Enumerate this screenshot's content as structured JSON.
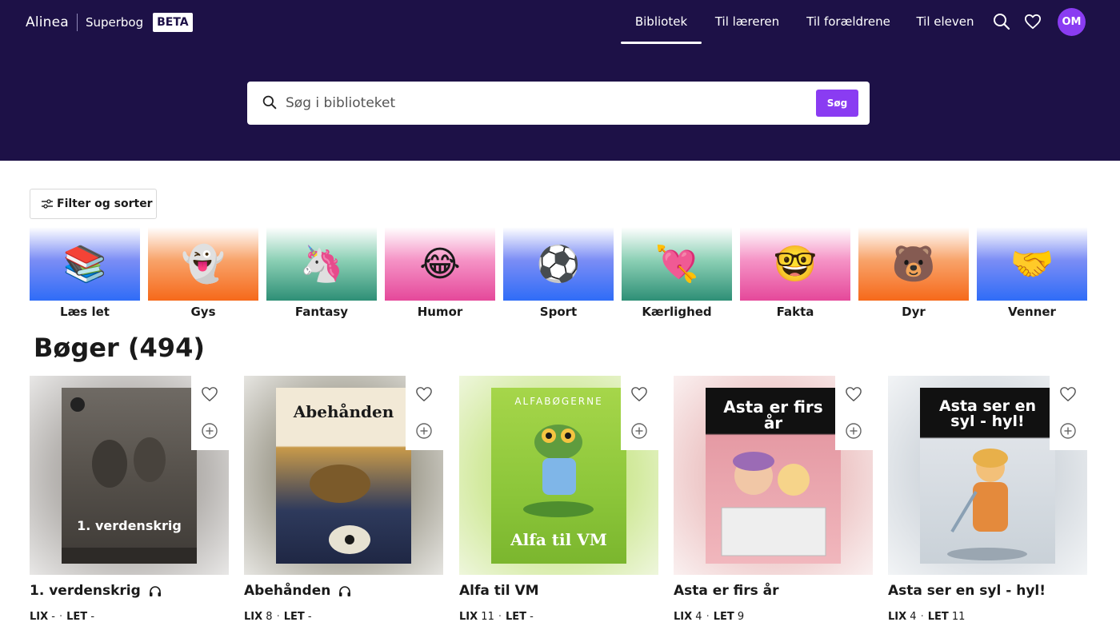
{
  "header": {
    "brand": "Alinea",
    "product": "Superbog",
    "badge": "BETA",
    "nav": [
      {
        "label": "Bibliotek",
        "active": true
      },
      {
        "label": "Til læreren",
        "active": false
      },
      {
        "label": "Til forældrene",
        "active": false
      },
      {
        "label": "Til eleven",
        "active": false
      }
    ],
    "icons": {
      "search": "search-icon",
      "favorites": "heart-icon"
    },
    "avatar_initials": "OM"
  },
  "search": {
    "placeholder": "Søg i biblioteket",
    "value": "",
    "button_label": "Søg"
  },
  "filter": {
    "label": "Filter og sorter",
    "icon": "sliders-icon"
  },
  "categories": [
    {
      "label": "Læs let",
      "emoji": "📚",
      "gradient": "blue"
    },
    {
      "label": "Gys",
      "emoji": "👻",
      "gradient": "orange"
    },
    {
      "label": "Fantasy",
      "emoji": "🦄",
      "gradient": "green"
    },
    {
      "label": "Humor",
      "emoji": "😂",
      "gradient": "pink"
    },
    {
      "label": "Sport",
      "emoji": "⚽",
      "gradient": "blue"
    },
    {
      "label": "Kærlighed",
      "emoji": "💘",
      "gradient": "green"
    },
    {
      "label": "Fakta",
      "emoji": "🤓",
      "gradient": "pink"
    },
    {
      "label": "Dyr",
      "emoji": "🐻",
      "gradient": "orange"
    },
    {
      "label": "Venner",
      "emoji": "🤝",
      "gradient": "blue"
    }
  ],
  "books_heading": "Bøger (494)",
  "books": [
    {
      "title": "1. verdenskrig",
      "audio": true,
      "lix_label": "LIX",
      "lix": "-",
      "let_label": "LET",
      "let": "-",
      "cover_text": "1. verdenskrig"
    },
    {
      "title": "Abehånden",
      "audio": true,
      "lix_label": "LIX",
      "lix": "8",
      "let_label": "LET",
      "let": "-",
      "cover_text": "Abehånden"
    },
    {
      "title": "Alfa til VM",
      "audio": false,
      "lix_label": "LIX",
      "lix": "11",
      "let_label": "LET",
      "let": "-",
      "cover_text": "Alfa til VM",
      "cover_series": "ALFABØGERNE"
    },
    {
      "title": "Asta er firs år",
      "audio": false,
      "lix_label": "LIX",
      "lix": "4",
      "let_label": "LET",
      "let": "9",
      "cover_text": "Asta er firs år"
    },
    {
      "title": "Asta ser en syl - hyl!",
      "audio": false,
      "lix_label": "LIX",
      "lix": "4",
      "let_label": "LET",
      "let": "11",
      "cover_text": "Asta ser en syl - hyl!"
    }
  ],
  "colors": {
    "header_bg": "#1d1147",
    "accent": "#8a3cf2"
  }
}
